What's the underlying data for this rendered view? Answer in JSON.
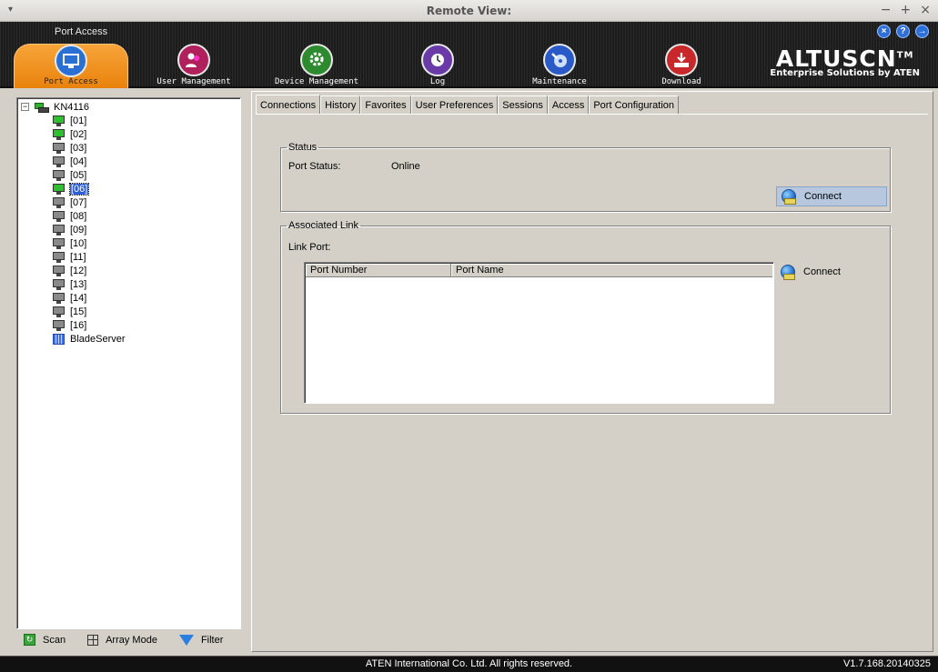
{
  "window": {
    "title": "Remote View:",
    "menu_glyph": "▾",
    "minimize": "−",
    "maximize": "+",
    "close": "×"
  },
  "header": {
    "breadcrumb": "Port Access",
    "nav": [
      {
        "label": "Port Access",
        "icon": "monitor-hand-icon",
        "color": "#2a6fd4"
      },
      {
        "label": "User Management",
        "icon": "users-icon",
        "color": "#b0205a"
      },
      {
        "label": "Device Management",
        "icon": "gear-icon",
        "color": "#2e8a2e"
      },
      {
        "label": "Log",
        "icon": "clock-icon",
        "color": "#6a3aa8"
      },
      {
        "label": "Maintenance",
        "icon": "wrench-disc-icon",
        "color": "#2a5ac8"
      },
      {
        "label": "Download",
        "icon": "download-icon",
        "color": "#c8282a"
      }
    ],
    "logo_brand": "ALTUSCN",
    "logo_tm": "TM",
    "logo_tag": "Enterprise Solutions by ATEN",
    "buttons": {
      "close": "×",
      "help": "?",
      "logout": "→"
    }
  },
  "tree": {
    "root": "KN4116",
    "expander": "−",
    "ports": [
      {
        "label": "[01]",
        "status": "online"
      },
      {
        "label": "[02]",
        "status": "online"
      },
      {
        "label": "[03]",
        "status": "offline"
      },
      {
        "label": "[04]",
        "status": "offline"
      },
      {
        "label": "[05]",
        "status": "offline"
      },
      {
        "label": "[06]",
        "status": "online",
        "selected": true
      },
      {
        "label": "[07]",
        "status": "offline"
      },
      {
        "label": "[08]",
        "status": "offline"
      },
      {
        "label": "[09]",
        "status": "offline"
      },
      {
        "label": "[10]",
        "status": "offline"
      },
      {
        "label": "[11]",
        "status": "offline"
      },
      {
        "label": "[12]",
        "status": "offline"
      },
      {
        "label": "[13]",
        "status": "offline"
      },
      {
        "label": "[14]",
        "status": "offline"
      },
      {
        "label": "[15]",
        "status": "offline"
      },
      {
        "label": "[16]",
        "status": "offline"
      }
    ],
    "blade": "BladeServer"
  },
  "tools": {
    "scan": "Scan",
    "array_mode": "Array Mode",
    "filter": "Filter"
  },
  "tabs": [
    "Connections",
    "History",
    "Favorites",
    "User Preferences",
    "Sessions",
    "Access",
    "Port Configuration"
  ],
  "status_group": {
    "legend": "Status",
    "port_status_label": "Port Status:",
    "port_status_value": "Online",
    "connect_label": "Connect"
  },
  "assoc_group": {
    "legend": "Associated Link",
    "link_port_label": "Link Port:",
    "columns": [
      "Port Number",
      "Port Name"
    ],
    "rows": [],
    "connect_label": "Connect"
  },
  "statusbar": {
    "copyright": "ATEN International Co. Ltd. All rights reserved.",
    "version": "V1.7.168.20140325"
  }
}
